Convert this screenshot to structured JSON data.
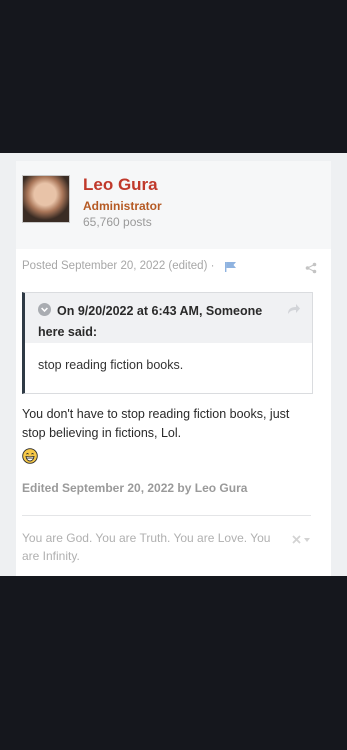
{
  "author": {
    "name": "Leo Gura",
    "role": "Administrator",
    "posts": "65,760 posts"
  },
  "post": {
    "posted": "Posted September 20, 2022 (edited) ·"
  },
  "quote": {
    "citation": "On 9/20/2022 at 6:43 AM, Someone here said:",
    "body": "stop reading fiction books."
  },
  "content": {
    "text": "You don't have to stop reading fiction books, just stop believing in fictions, Lol.",
    "emoji": "grinning-face-icon"
  },
  "edited": "Edited September 20, 2022 by Leo Gura",
  "signature": "You are God. You are Truth. You are Love. You are Infinity.",
  "colors": {
    "author_name": "#c0392b",
    "role": "#b55a24",
    "quote_border": "#2f3a45",
    "flag": "#8fb3e0"
  }
}
